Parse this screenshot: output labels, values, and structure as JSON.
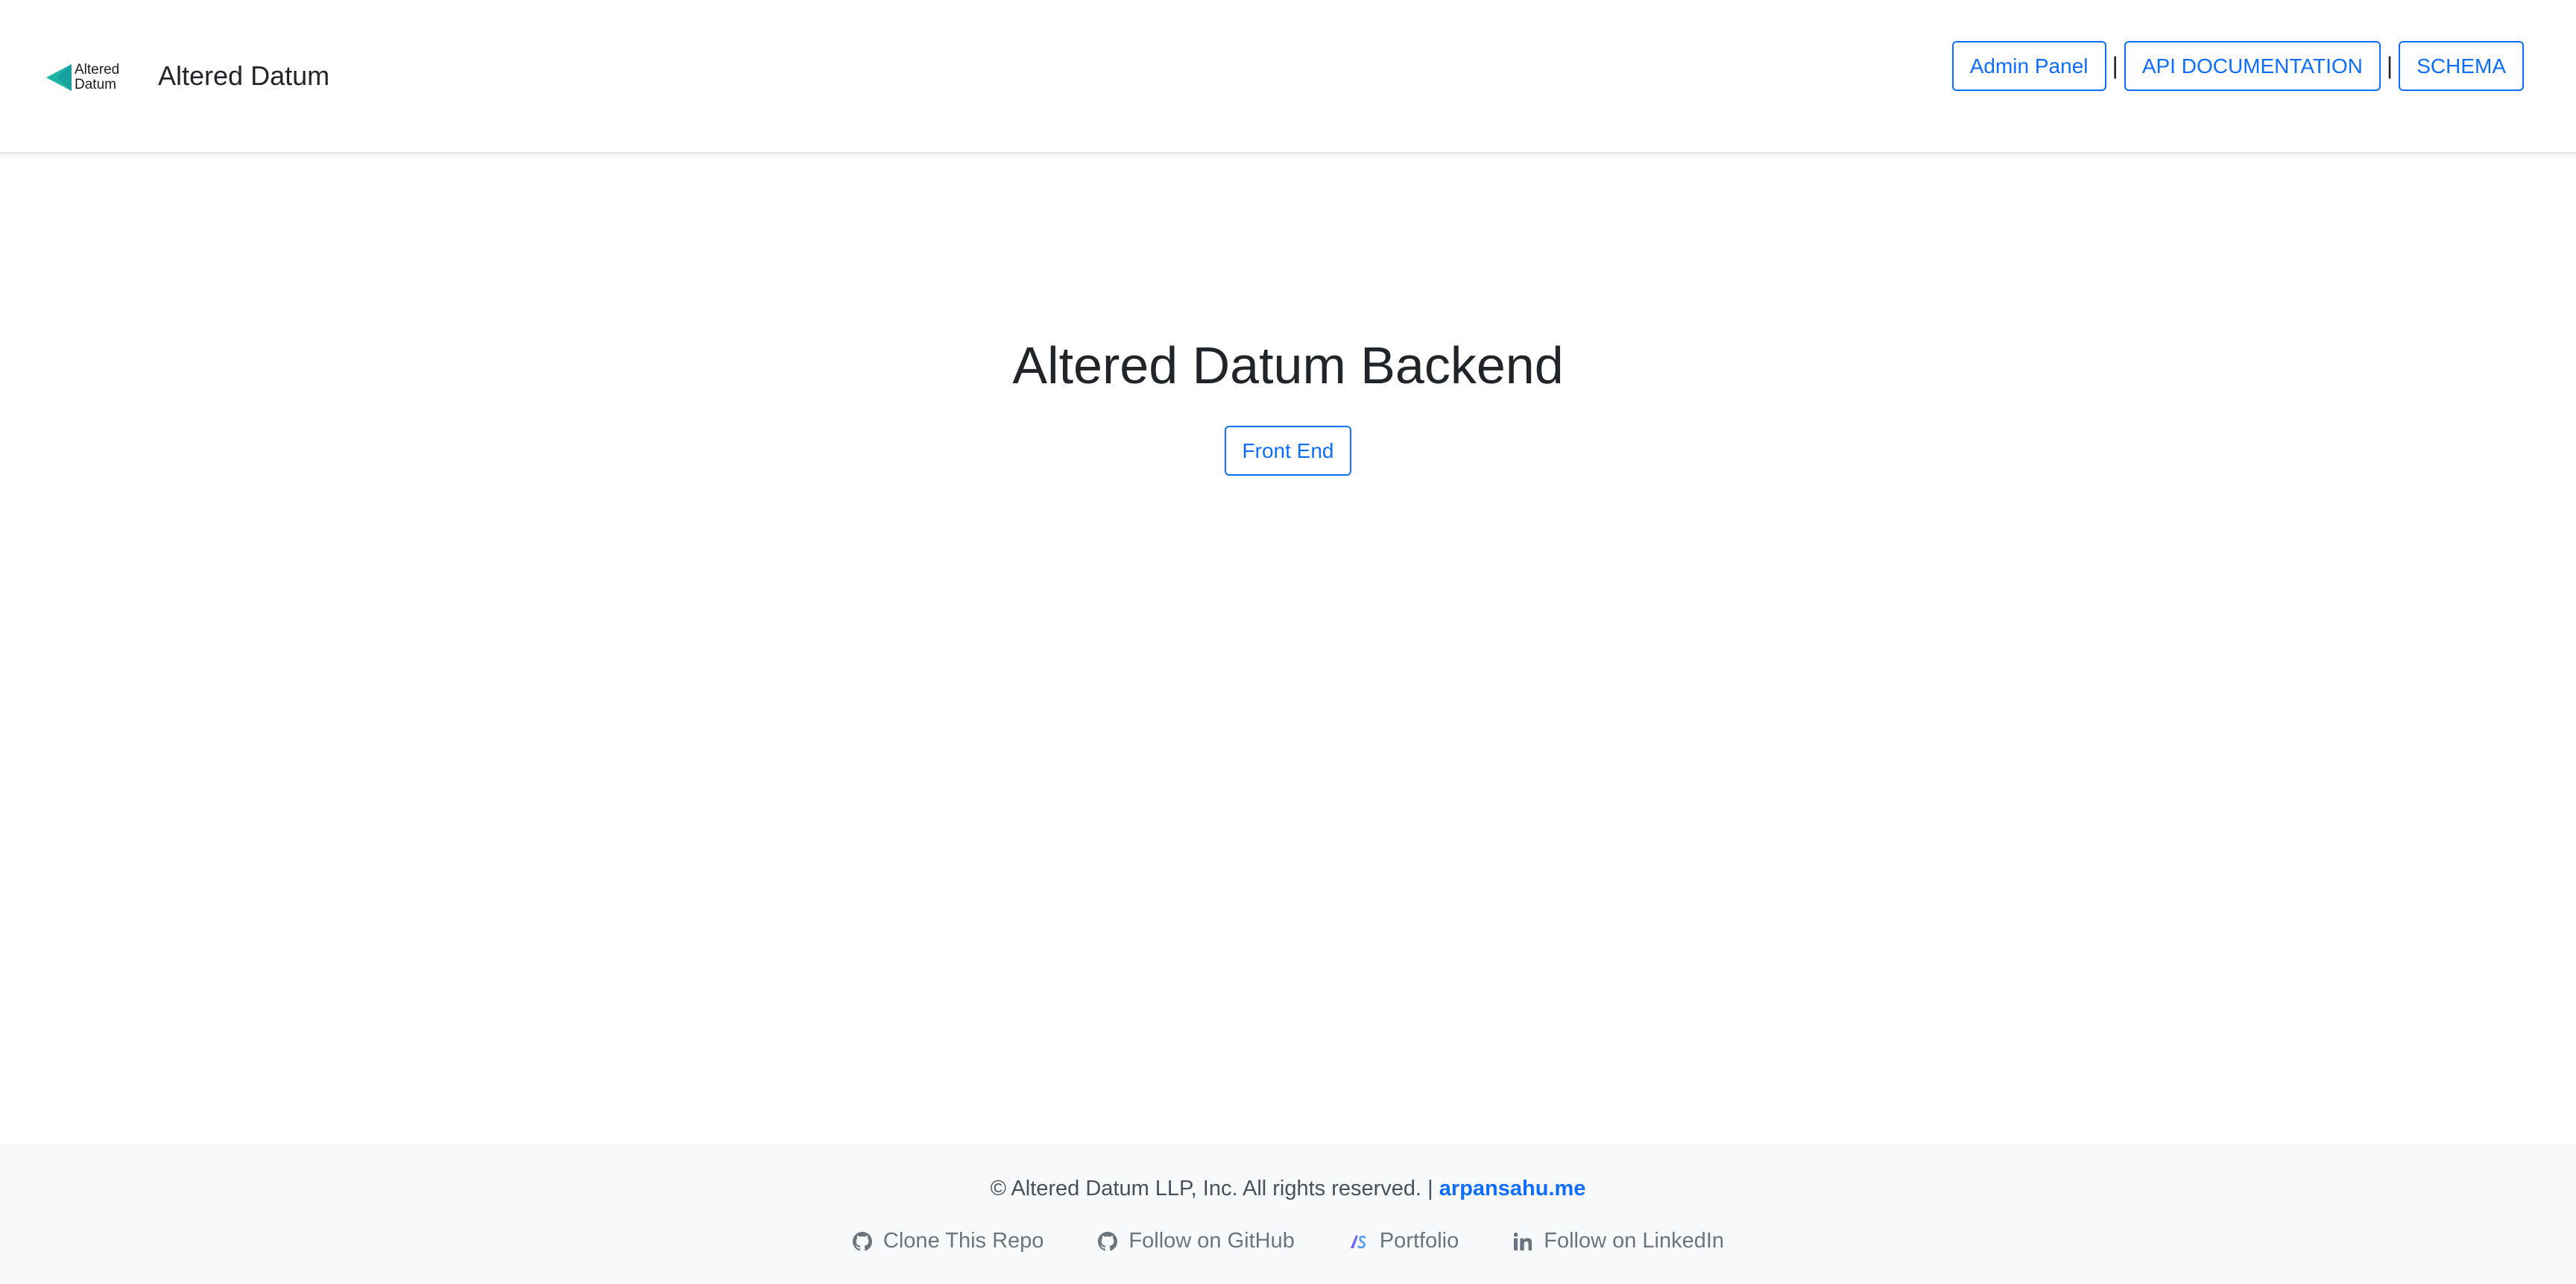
{
  "header": {
    "logo_text_line1": "Altered",
    "logo_text_line2": "Datum",
    "brand_title": "Altered Datum",
    "nav": [
      {
        "label": "Admin Panel"
      },
      {
        "label": "API DOCUMENTATION"
      },
      {
        "label": "SCHEMA"
      }
    ],
    "separator": "|"
  },
  "main": {
    "title": "Altered Datum Backend",
    "button_label": "Front End"
  },
  "footer": {
    "copyright": "© Altered Datum LLP, Inc. All rights reserved. |",
    "copyright_link": "arpansahu.me",
    "links": [
      {
        "label": "Clone This Repo",
        "icon": "github-icon"
      },
      {
        "label": "Follow on GitHub",
        "icon": "github-icon"
      },
      {
        "label": "Portfolio",
        "icon": "portfolio-logo-icon"
      },
      {
        "label": "Follow on LinkedIn",
        "icon": "linkedin-icon"
      }
    ]
  },
  "colors": {
    "accent": "#0d6efd",
    "logo_teal": "#1fb5a6",
    "footer_bg": "#f8f9fa"
  }
}
